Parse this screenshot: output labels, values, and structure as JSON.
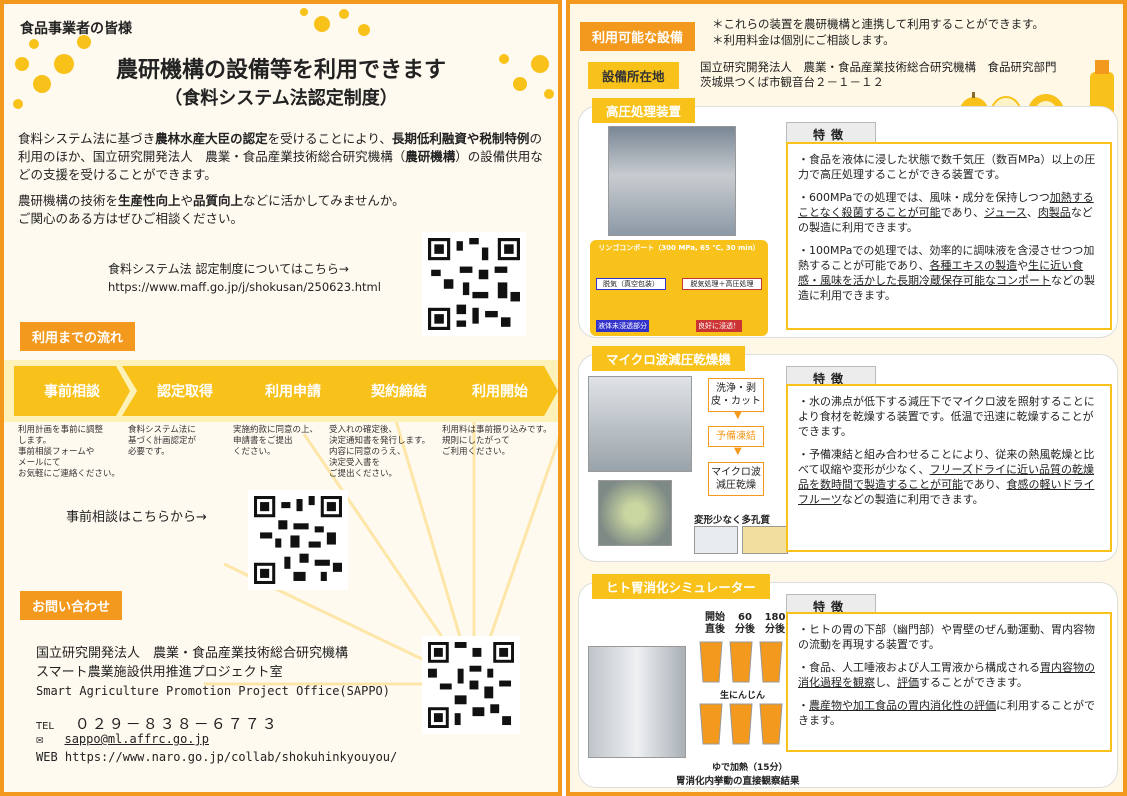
{
  "left": {
    "greeting": "食品事業者の皆様",
    "title": "農研機構の設備等を利用できます",
    "subtitle": "（食料システム法認定制度）",
    "intro_p1_a": "食料システム法に基づき",
    "intro_p1_b": "農林水産大臣の認定",
    "intro_p1_c": "を受けることにより、",
    "intro_p1_d": "長期低利融資や税制特例",
    "intro_p1_e": "の利用のほか、国立研究開発法人　農業・食品産業技術総合研究機構（",
    "intro_p1_f": "農研機構",
    "intro_p1_g": "）の設備供用などの支援を受けることができます。",
    "intro_p2_a": "農研機構の技術を",
    "intro_p2_b": "生産性向上",
    "intro_p2_c": "や",
    "intro_p2_d": "品質向上",
    "intro_p2_e": "などに活かしてみませんか。",
    "intro_p3": "ご関心のある方はぜひご相談ください。",
    "link_label": "食料システム法 認定制度についてはこちら→",
    "link_url": "https://www.maff.go.jp/j/shokusan/250623.html",
    "flow_tag": "利用までの流れ",
    "steps": [
      {
        "label": "事前相談",
        "desc": [
          "利用計画を事前に調整",
          "します。",
          "事前相談フォームや",
          "メールにて",
          "お気軽にご連絡ください。"
        ]
      },
      {
        "label": "認定取得",
        "desc": [
          "食料システム法に",
          "基づく計画認定が",
          "必要です。"
        ]
      },
      {
        "label": "利用申請",
        "desc": [
          "実施約款に同意の上、",
          "申請書をご提出",
          "ください。"
        ]
      },
      {
        "label": "契約締結",
        "desc": [
          "受入れの確定後、",
          "決定通知書を発行します。",
          "内容に同意のうえ、",
          "決定受入書を",
          "ご提出ください。"
        ]
      },
      {
        "label": "利用開始",
        "desc": [
          "利用料は事前振り込みです。",
          "規則にしたがって",
          "ご利用ください。"
        ]
      }
    ],
    "consult_label": "事前相談はこちらから→",
    "contact_tag": "お問い合わせ",
    "org1": "国立研究開発法人　農業・食品産業技術総合研究機構",
    "org2": "スマート農業施設供用推進プロジェクト室",
    "org3": "Smart Agriculture Promotion Project Office(SAPPO)",
    "tel_label": "TEL",
    "tel": "０２９－８３８－６７７３",
    "email": "sappo@ml.affrc.go.jp",
    "web_label": "WEB",
    "web_url": "https://www.naro.go.jp/collab/shokuhinkyouyou/"
  },
  "right": {
    "avail_tag": "利用可能な設備",
    "note1": "＊これらの装置を農研機構と連携して利用することができます。",
    "note2": "＊利用料金は個別にご相談します。",
    "loc_tag": "設備所在地",
    "loc1": "国立研究開発法人　農業・食品産業技術総合研究機構　食品研究部門",
    "loc2": "茨城県つくば市観音台２－１－１２",
    "feature_hd": "特徴",
    "hpp": {
      "tag": "高圧処理装置",
      "photo_caption": "リンゴコンポート（300 MPa, 65 ℃, 30 min）",
      "label_a": "脱気（真空包装）",
      "label_b": "脱気処理＋高圧処理",
      "label_c": "液体未浸透部分",
      "label_d": "良好に浸透！",
      "p1": "・食品を液体に浸した状態で数千気圧（数百MPa）以上の圧力で高圧処理することができる装置です。",
      "p2_a": "・600MPaでの処理では、風味・成分を保持しつつ",
      "p2_b": "加熱することなく殺菌することが可能",
      "p2_c": "であり、",
      "p2_d": "ジュース",
      "p2_e": "、",
      "p2_f": "肉製品",
      "p2_g": "などの製造に利用できます。",
      "p3_a": "・100MPaでの処理では、効率的に調味液を含浸させつつ加熱することが可能であり、",
      "p3_b": "各種エキスの製造",
      "p3_c": "や",
      "p3_d": "生に近い食感・風味を活かした長期冷蔵保存可能なコンポート",
      "p3_e": "などの製造に利用できます。"
    },
    "mw": {
      "tag": "マイクロ波減圧乾燥機",
      "proc1": "洗浄・剥皮・カット",
      "proc2": "予備凍結",
      "proc3": "マイクロ波減圧乾燥",
      "caption": "変形少なく多孔質",
      "p1": "・水の沸点が低下する減圧下でマイクロ波を照射することにより食材を乾燥する装置です。低温で迅速に乾燥することができます。",
      "p2_a": "・予備凍結と組み合わせることにより、従来の熱風乾燥と比べて収縮や変形が少なく、",
      "p2_b": "フリーズドライに近い品質の乾燥品を数時間で製造することが可能",
      "p2_c": "であり、",
      "p2_d": "食感の軽いドライフルーツ",
      "p2_e": "などの製造に利用できます。"
    },
    "sim": {
      "tag": "ヒト胃消化シミュレーター",
      "col_heads": [
        "開始",
        "60",
        "180"
      ],
      "col_sub": [
        "直後",
        "分後",
        "分後"
      ],
      "label_raw": "生にんじん",
      "label_boiled": "ゆで加熱（15分）",
      "caption": "胃消化内挙動の直接観察結果",
      "p1": "・ヒトの胃の下部（幽門部）や胃壁のぜん動運動、胃内容物の流動を再現する装置です。",
      "p2_a": "・食品、人工唾液および人工胃液から構成される",
      "p2_b": "胃内容物の消化過程を観察",
      "p2_c": "し、",
      "p2_d": "評価",
      "p2_e": "することができます。",
      "p3_a": "・",
      "p3_b": "農産物や加工食品の胃内消化性の評価",
      "p3_c": "に利用することができます。"
    }
  },
  "colors": {
    "orange": "#f39a1e",
    "yellow": "#f8c21b",
    "cream": "#fff8e6"
  }
}
